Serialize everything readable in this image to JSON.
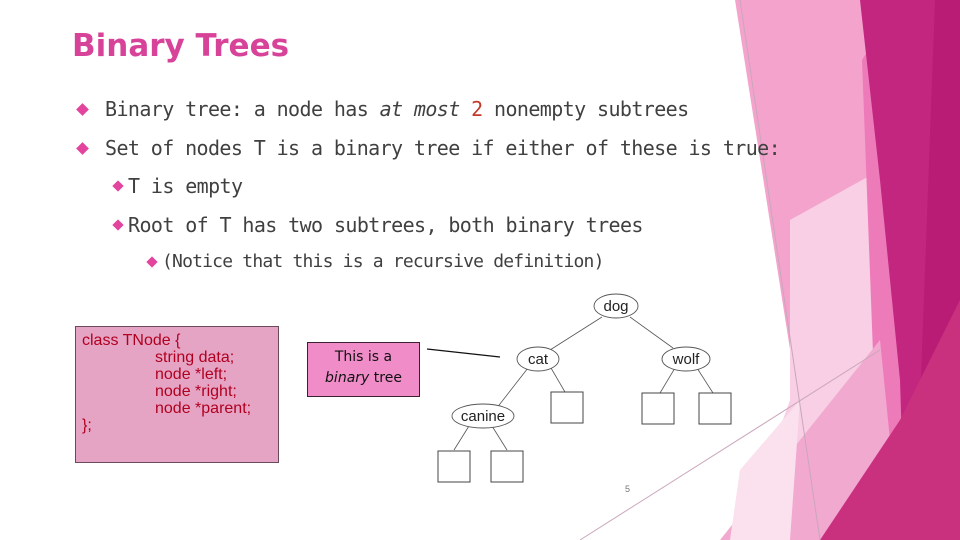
{
  "slide": {
    "title": "Binary Trees",
    "page_number": "5",
    "colors": {
      "title": "#d8439a",
      "bullet": "#e2449e",
      "accent_number": "#c0392b",
      "code_bg": "#e6a4c4",
      "code_text": "#b00020",
      "callout_bg": "#f08cc8"
    }
  },
  "bullets": [
    {
      "level": 1,
      "pre": "Binary tree: a node has ",
      "em": "at most",
      "num": "2",
      "post": " nonempty subtrees"
    },
    {
      "level": 1,
      "text": "Set of nodes T is a binary tree if either of these is true:"
    },
    {
      "level": 2,
      "text": "T is empty"
    },
    {
      "level": 2,
      "text": "Root of T has two subtrees, both binary trees"
    },
    {
      "level": 3,
      "text": "(Notice that this is a recursive definition)"
    }
  ],
  "code": {
    "lines": [
      "class TNode {",
      "string data;",
      "node *left;",
      "node *right;",
      "node *parent;",
      "};"
    ]
  },
  "callout": {
    "line1": "This is a",
    "line2_em": "binary",
    "line2_rest": " tree"
  },
  "tree": {
    "nodes": [
      "dog",
      "cat",
      "wolf",
      "canine"
    ]
  }
}
